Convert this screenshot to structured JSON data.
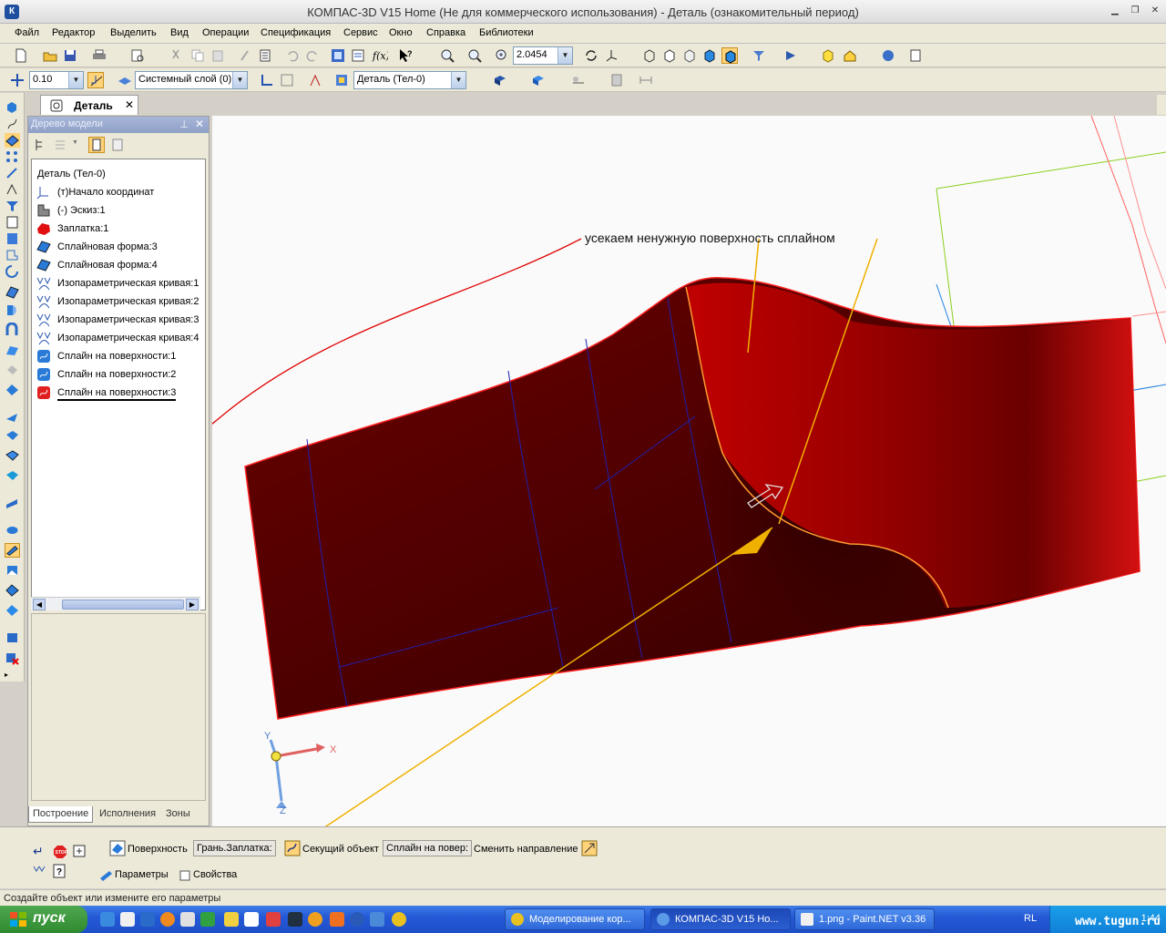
{
  "window": {
    "title": "КОМПАС-3D V15 Home (Не для коммерческого использования) - Деталь (ознакомительный период)",
    "app_icon_letter": "К"
  },
  "menu": [
    "Файл",
    "Редактор",
    "Выделить",
    "Вид",
    "Операции",
    "Спецификация",
    "Сервис",
    "Окно",
    "Справка",
    "Библиотеки"
  ],
  "toolbar": {
    "zoom_value": "2.0454",
    "step_value": "0.10",
    "layer_value": "Системный слой (0)",
    "part_value": "Деталь (Тел-0)"
  },
  "doc_tab": {
    "label": "Деталь"
  },
  "tree": {
    "header": "Дерево модели",
    "items": [
      {
        "label": "Деталь (Тел-0)",
        "icon": "part-icon"
      },
      {
        "label": "(т)Начало координат",
        "icon": "origin-icon"
      },
      {
        "label": "(-) Эскиз:1",
        "icon": "sketch-icon"
      },
      {
        "label": "Заплатка:1",
        "icon": "patch-icon"
      },
      {
        "label": "Сплайновая форма:3",
        "icon": "spline-form-icon"
      },
      {
        "label": "Сплайновая форма:4",
        "icon": "spline-form-icon"
      },
      {
        "label": "Изопараметрическая кривая:1",
        "icon": "isoparametric-curve-icon"
      },
      {
        "label": "Изопараметрическая кривая:2",
        "icon": "isoparametric-curve-icon"
      },
      {
        "label": "Изопараметрическая кривая:3",
        "icon": "isoparametric-curve-icon"
      },
      {
        "label": "Изопараметрическая кривая:4",
        "icon": "isoparametric-curve-icon"
      },
      {
        "label": "Сплайн на поверхности:1",
        "icon": "surface-spline-icon"
      },
      {
        "label": "Сплайн на поверхности:2",
        "icon": "surface-spline-icon"
      },
      {
        "label": "Сплайн на поверхности:3",
        "icon": "surface-spline-icon-active"
      }
    ],
    "tabs": [
      "Построение",
      "Исполнения",
      "Зоны"
    ]
  },
  "viewport": {
    "annotation": "усекаем ненужную поверхность сплайном",
    "axis_x": "X",
    "axis_y": "Y",
    "axis_z": "Z",
    "colors": {
      "surface": "#8a0000",
      "surface_dark": "#3a0000",
      "edge": "#ff2020",
      "spline": "#ff9a30",
      "leader": "#f0b000",
      "leader_red": "#e00000"
    }
  },
  "props": {
    "surface_label": "Поверхность",
    "surface_value": "Грань.Заплатка:",
    "cutter_label": "Секущий объект",
    "cutter_value": "Сплайн на повер:",
    "direction_label": "Сменить направление",
    "tabs": [
      "Параметры",
      "Свойства"
    ]
  },
  "status": "Создайте объект или измените его параметры",
  "taskbar": {
    "start": "пуск",
    "tasks": [
      "Моделирование кор...",
      "КОМПАС-3D V15 Ho...",
      "1.png - Paint.NET v3.36"
    ],
    "lang": "RL",
    "clock": "1:44",
    "watermark": "www.tugun.ru"
  }
}
